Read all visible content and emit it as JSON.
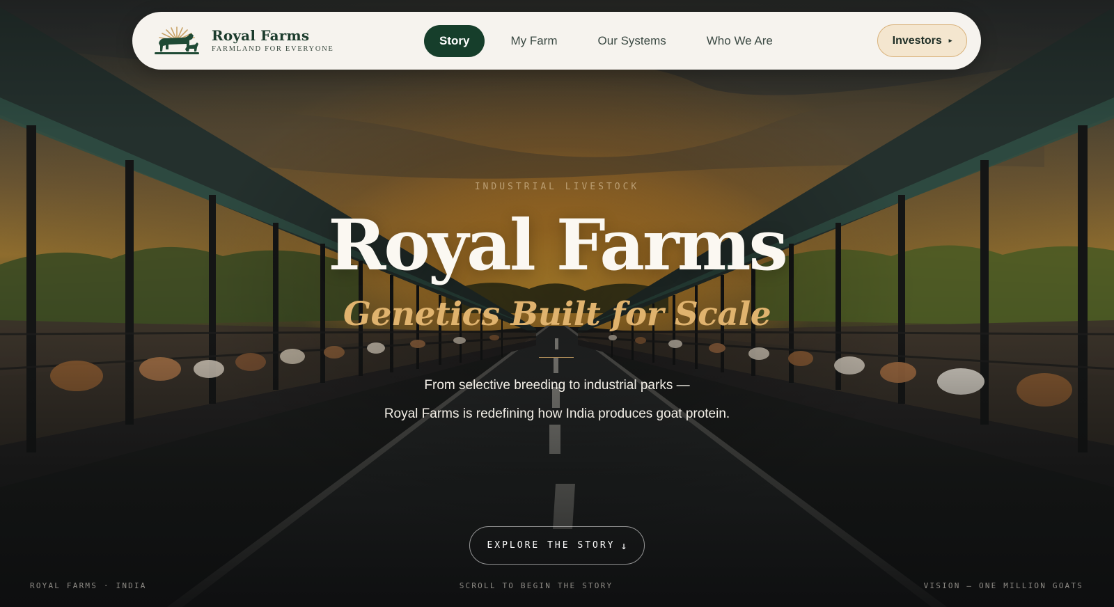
{
  "brand": {
    "name": "Royal Farms",
    "tagline": "FARMLAND FOR EVERYONE",
    "logo_icon": "sunrise-cow-goat-logo"
  },
  "nav": {
    "links": [
      {
        "label": "Story",
        "active": true
      },
      {
        "label": "My Farm",
        "active": false
      },
      {
        "label": "Our Systems",
        "active": false
      },
      {
        "label": "Who We Are",
        "active": false
      }
    ],
    "cta": {
      "label": "Investors",
      "icon": "caret-right-icon"
    }
  },
  "hero": {
    "eyebrow": "INDUSTRIAL LIVESTOCK",
    "title": "Royal Farms",
    "subtitle": "Genetics Built for Scale",
    "description_line1": "From selective breeding to industrial parks —",
    "description_line2": "Royal Farms is redefining how India produces goat protein.",
    "cta": {
      "label": "EXPLORE THE STORY",
      "icon": "arrow-down-icon",
      "glyph": "↓"
    }
  },
  "footer": {
    "left": "ROYAL FARMS · INDIA",
    "center": "SCROLL TO BEGIN THE STORY",
    "right": "VISION — ONE MILLION GOATS"
  },
  "colors": {
    "brand_green": "#163e2b",
    "accent_gold": "#e0b36e",
    "nav_background": "#f6f3ee",
    "cta_cream": "#f4e6cf"
  }
}
